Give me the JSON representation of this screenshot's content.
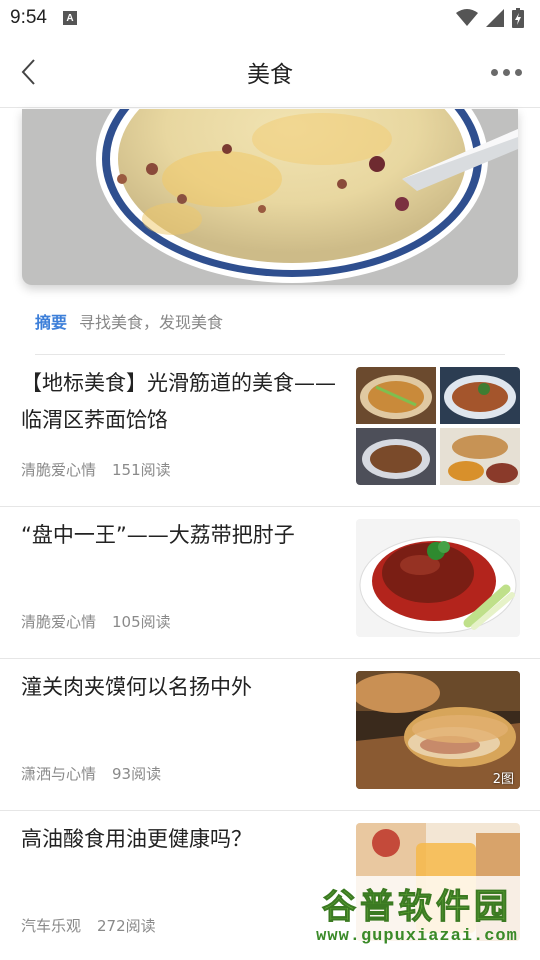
{
  "status_bar": {
    "time": "9:54",
    "notification_icon": "A"
  },
  "app_bar": {
    "title": "美食"
  },
  "summary": {
    "label": "摘要",
    "text": "寻找美食，发现美食"
  },
  "articles": [
    {
      "title": "【地标美食】光滑筋道的美食——临渭区荞面饸饹",
      "author": "清脆爱心情",
      "reads": "151阅读",
      "badge": ""
    },
    {
      "title": "“盘中一王”——大荔带把肘子",
      "author": "清脆爱心情",
      "reads": "105阅读",
      "badge": ""
    },
    {
      "title": "潼关肉夹馍何以名扬中外",
      "author": "潇洒与心情",
      "reads": "93阅读",
      "badge": "2图"
    },
    {
      "title": "高油酸食用油更健康吗？",
      "author": "汽车乐观",
      "reads": "272阅读",
      "badge": ""
    }
  ],
  "watermark": {
    "title": "谷普软件园",
    "url": "www.gupuxiazai.com"
  },
  "colors": {
    "accent": "#3d7fd9",
    "divider": "#e6e6e6",
    "meta_text": "#8a8a8a",
    "watermark_green": "#6db33f"
  }
}
